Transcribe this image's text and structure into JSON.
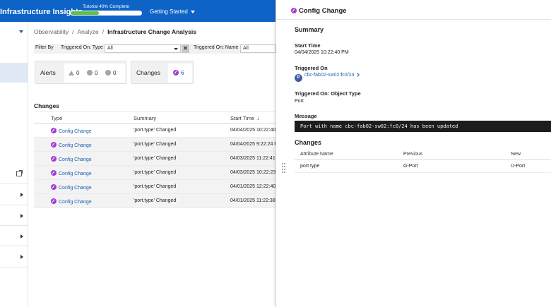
{
  "header": {
    "app_title": "Infrastructure Insights",
    "tutorial_label": "Tutorial 40% Complete",
    "tutorial_progress_pct": 40,
    "getting_started": "Getting Started"
  },
  "breadcrumb": {
    "items": [
      "Observability",
      "Analyze"
    ],
    "current": "Infrastructure Change Analysis",
    "separator": "/"
  },
  "filters": {
    "filter_by": "Filter By",
    "triggered_on_type_label": "Triggered On: Type",
    "triggered_on_type_value": "All",
    "clear": "✕",
    "triggered_on_name_label": "Triggered On: Name",
    "triggered_on_name_value": "All"
  },
  "cards": {
    "alerts_label": "Alerts",
    "alerts_counts": [
      "0",
      "0",
      "0"
    ],
    "changes_label": "Changes",
    "changes_count": "6"
  },
  "changes_table": {
    "title": "Changes",
    "columns": [
      "Type",
      "Summary",
      "Start Time"
    ],
    "sort_indicator": "↓",
    "rows": [
      {
        "type": "Config Change",
        "summary": "'port.type' Changed",
        "start": "04/04/2025 10:22:40 P"
      },
      {
        "type": "Config Change",
        "summary": "'port.type' Changed",
        "start": "04/04/2025 9:22:24 PM"
      },
      {
        "type": "Config Change",
        "summary": "'port.type' Changed",
        "start": "04/03/2025 11:22:41 P"
      },
      {
        "type": "Config Change",
        "summary": "'port.type' Changed",
        "start": "04/03/2025 10:22:23 P"
      },
      {
        "type": "Config Change",
        "summary": "'port.type' Changed",
        "start": "04/01/2025 12:22:40 P"
      },
      {
        "type": "Config Change",
        "summary": "'port.type' Changed",
        "start": "04/01/2025 11:22:38 A"
      }
    ]
  },
  "detail": {
    "title": "Config Change",
    "summary_heading": "Summary",
    "start_time_label": "Start Time",
    "start_time_value": "04/04/2025 10:22:40 PM",
    "triggered_on_label": "Triggered On",
    "triggered_on_badge": "P",
    "triggered_on_value": "cbc-fab02-sw02:fc0/24",
    "object_type_label": "Triggered On: Object Type",
    "object_type_value": "Port",
    "message_label": "Message",
    "message_value": "Port with name cbc-fab02-sw02:fc0/24 has been updated",
    "changes_heading": "Changes",
    "changes_columns": [
      "Attribute Name",
      "Previous",
      "New"
    ],
    "changes_rows": [
      {
        "attribute": "port.type",
        "previous": "G-Port",
        "new": "U-Port"
      }
    ]
  },
  "colors": {
    "brand_blue": "#0e63c7",
    "link_blue": "#1f5fb5",
    "config_purple": "#a43bd6",
    "progress_green": "#5fbf3f"
  }
}
